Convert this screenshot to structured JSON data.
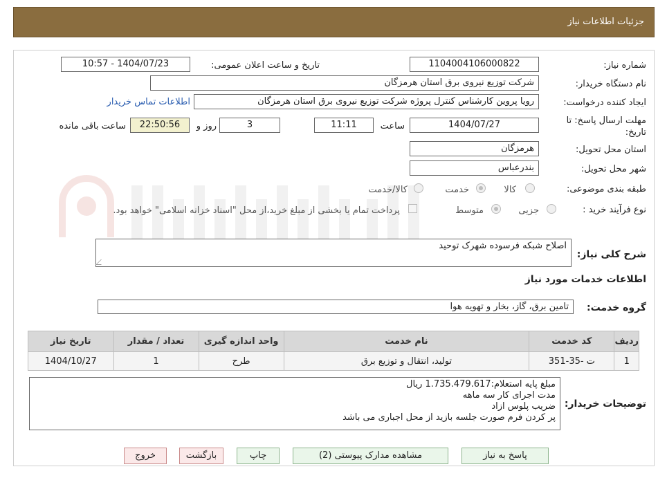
{
  "header": {
    "title": "جزئیات اطلاعات نیاز"
  },
  "form": {
    "need_number_label": "شماره نیاز:",
    "need_number": "1104004106000822",
    "announce_label": "تاریخ و ساعت اعلان عمومی:",
    "announce_value": "1404/07/23 - 10:57",
    "buyer_org_label": "نام دستگاه خریدار:",
    "buyer_org": "شرکت توزیع نیروی برق استان هرمزگان",
    "creator_label": "ایجاد کننده درخواست:",
    "creator": "رویا پروین کارشناس کنترل پروژه شرکت توزیع نیروی برق استان هرمزگان",
    "contact_link": "اطلاعات تماس خریدار",
    "deadline_label": "مهلت ارسال پاسخ: تا تاریخ:",
    "deadline_date": "1404/07/27",
    "time_label": "ساعت",
    "deadline_time": "11:11",
    "days_value": "3",
    "days_label": "روز و",
    "remaining_time": "22:50:56",
    "remaining_label": "ساعت باقی مانده",
    "province_label": "استان محل تحویل:",
    "province": "هرمزگان",
    "city_label": "شهر محل تحویل:",
    "city": "بندرعباس",
    "category_label": "طبقه بندی موضوعی:",
    "category_options": [
      "کالا",
      "خدمت",
      "کالا/خدمت"
    ],
    "process_label": "نوع فرآیند خرید :",
    "process_options": [
      "جزیی",
      "متوسط"
    ],
    "payment_note": "پرداخت تمام یا بخشی از مبلغ خرید،از محل \"اسناد خزانه اسلامی\" خواهد بود."
  },
  "need_desc": {
    "label": "شرح کلی نیاز:",
    "value": "اصلاح شبکه فرسوده شهرک توحید"
  },
  "services": {
    "section_title": "اطلاعات خدمات مورد نیاز",
    "group_label": "گروه خدمت:",
    "group_value": "تامین برق، گاز، بخار و تهویه هوا",
    "columns": [
      "ردیف",
      "کد خدمت",
      "نام خدمت",
      "واحد اندازه گیری",
      "تعداد / مقدار",
      "تاریخ نیاز"
    ],
    "rows": [
      [
        "1",
        "ت -35-351",
        "تولید، انتقال و توزیع برق",
        "طرح",
        "1",
        "1404/10/27"
      ]
    ]
  },
  "buyer_notes": {
    "label": "توضیحات خریدار:",
    "lines": [
      "مبلغ پایه استعلام:1.735.479.617 ریال",
      "مدت اجرای کار سه ماهه",
      "ضریب پلوس ازاد",
      "پر کردن فرم صورت جلسه بازید از محل اجباری می باشد"
    ]
  },
  "buttons": {
    "reply": "پاسخ به نیاز",
    "attachments": "مشاهده مدارک پیوستی (2)",
    "print": "چاپ",
    "back": "بازگشت",
    "exit": "خروج"
  }
}
